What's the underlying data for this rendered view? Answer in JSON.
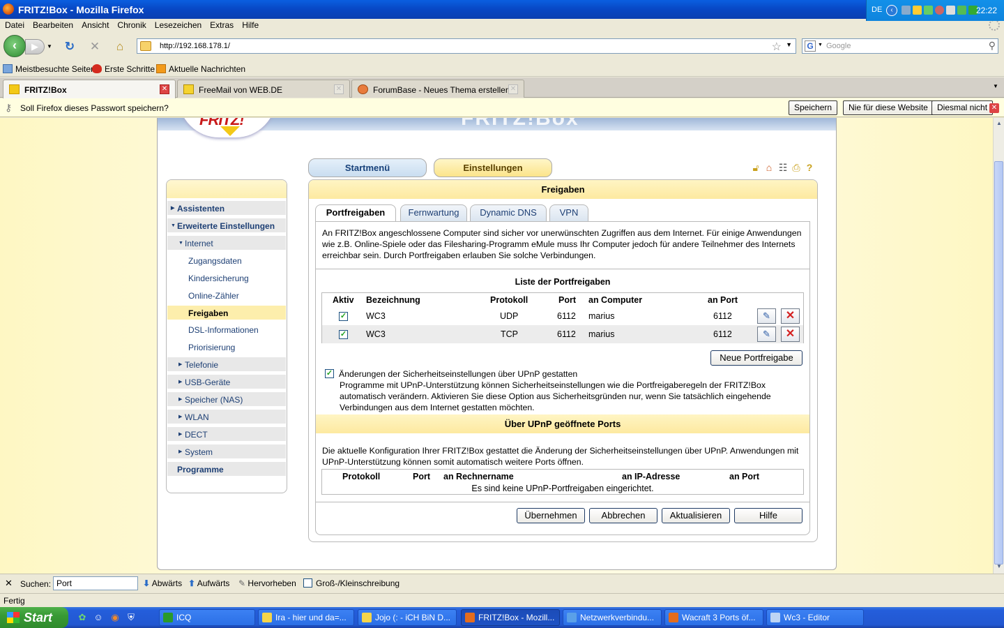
{
  "window": {
    "title": "FRITZ!Box - Mozilla Firefox"
  },
  "menu": [
    "Datei",
    "Bearbeiten",
    "Ansicht",
    "Chronik",
    "Lesezeichen",
    "Extras",
    "Hilfe"
  ],
  "nav": {
    "url": "http://192.168.178.1/",
    "search_placeholder": "Google"
  },
  "bookmarks": [
    "Meistbesuchte Seiten",
    "Erste Schritte",
    "Aktuelle Nachrichten"
  ],
  "tabs": [
    {
      "label": "FRITZ!Box"
    },
    {
      "label": "FreeMail von WEB.DE"
    },
    {
      "label": "ForumBase - Neues Thema erstellen"
    }
  ],
  "notification": {
    "message": "Soll Firefox dieses Passwort speichern?",
    "save": "Speichern",
    "never": "Nie für diese Website",
    "not_now": "Diesmal nicht"
  },
  "fritz": {
    "top_buttons": {
      "start": "Startmenü",
      "settings": "Einstellungen"
    },
    "sidebar": [
      {
        "label": "Assistenten",
        "level": 0
      },
      {
        "label": "Erweiterte Einstellungen",
        "level": 0
      },
      {
        "label": "Internet",
        "level": 1
      },
      {
        "label": "Zugangsdaten",
        "level": 2
      },
      {
        "label": "Kindersicherung",
        "level": 2
      },
      {
        "label": "Online-Zähler",
        "level": 2
      },
      {
        "label": "Freigaben",
        "level": 2
      },
      {
        "label": "DSL-Informationen",
        "level": 2
      },
      {
        "label": "Priorisierung",
        "level": 2
      },
      {
        "label": "Telefonie",
        "level": 1
      },
      {
        "label": "USB-Geräte",
        "level": 1
      },
      {
        "label": "Speicher (NAS)",
        "level": 1
      },
      {
        "label": "WLAN",
        "level": 1
      },
      {
        "label": "DECT",
        "level": 1
      },
      {
        "label": "System",
        "level": 1
      },
      {
        "label": "Programme",
        "level": 0
      }
    ],
    "panel_title": "Freigaben",
    "subtabs": [
      "Portfreigaben",
      "Fernwartung",
      "Dynamic DNS",
      "VPN"
    ],
    "intro": "An FRITZ!Box angeschlossene Computer sind sicher vor unerwünschten Zugriffen aus dem Internet. Für einige Anwendungen wie z.B. Online-Spiele oder das Filesharing-Programm eMule muss Ihr Computer jedoch für andere Teilnehmer des Internets erreichbar sein. Durch Portfreigaben erlauben Sie solche Verbindungen.",
    "list_heading": "Liste der Portfreigaben",
    "columns": [
      "Aktiv",
      "Bezeichnung",
      "Protokoll",
      "Port",
      "an Computer",
      "an Port"
    ],
    "rows": [
      {
        "active": "✓",
        "name": "WC3",
        "proto": "UDP",
        "port": "6112",
        "computer": "marius",
        "to_port": "6112"
      },
      {
        "active": "✓",
        "name": "WC3",
        "proto": "TCP",
        "port": "6112",
        "computer": "marius",
        "to_port": "6112"
      }
    ],
    "new_button": "Neue Portfreigabe",
    "upnp_check_label": "Änderungen der Sicherheitseinstellungen über UPnP gestatten",
    "upnp_check_desc": "Programme mit UPnP-Unterstützung können Sicherheitseinstellungen wie die Portfreigaberegeln der FRITZ!Box automatisch verändern. Aktivieren Sie diese Option aus Sicherheitsgründen nur, wenn Sie tatsächlich eingehende Verbindungen aus dem Internet gestatten möchten.",
    "upnp_heading": "Über UPnP geöffnete Ports",
    "upnp_intro": "Die aktuelle Konfiguration Ihrer FRITZ!Box gestattet die Änderung der Sicherheitseinstellungen über UPnP. Anwendungen mit UPnP-Unterstützung können somit automatisch weitere Ports öffnen.",
    "upnp_columns": [
      "Protokoll",
      "Port",
      "an Rechnername",
      "an IP-Adresse",
      "an Port"
    ],
    "upnp_empty": "Es sind keine UPnP-Portfreigaben eingerichtet.",
    "buttons": [
      "Übernehmen",
      "Abbrechen",
      "Aktualisieren",
      "Hilfe"
    ]
  },
  "findbar": {
    "close": "✕",
    "label": "Suchen:",
    "value": "Port",
    "down": "Abwärts",
    "up": "Aufwärts",
    "highlight": "Hervorheben",
    "case": "Groß-/Kleinschreibung"
  },
  "status": "Fertig",
  "taskbar": {
    "start": "Start",
    "tasks": [
      {
        "label": "ICQ",
        "color": "#2a9a2a"
      },
      {
        "label": "Ira - hier und da=...",
        "color": "#f5d54a"
      },
      {
        "label": "Jojo (: - iCH BiN D...",
        "color": "#f5d54a"
      },
      {
        "label": "FRITZ!Box - Mozill...",
        "color": "#e36c1e"
      },
      {
        "label": "Netzwerkverbindu...",
        "color": "#5aa0e8"
      },
      {
        "label": "Wacraft 3 Ports öf...",
        "color": "#e36c1e"
      },
      {
        "label": "Wc3 - Editor",
        "color": "#bcd4f4"
      }
    ],
    "lang": "DE",
    "clock": "22:22"
  },
  "colors": {
    "fritz_yellow": "#fde9a0",
    "fritz_blue": "#1d3f74",
    "xp_blue": "#245edb"
  }
}
